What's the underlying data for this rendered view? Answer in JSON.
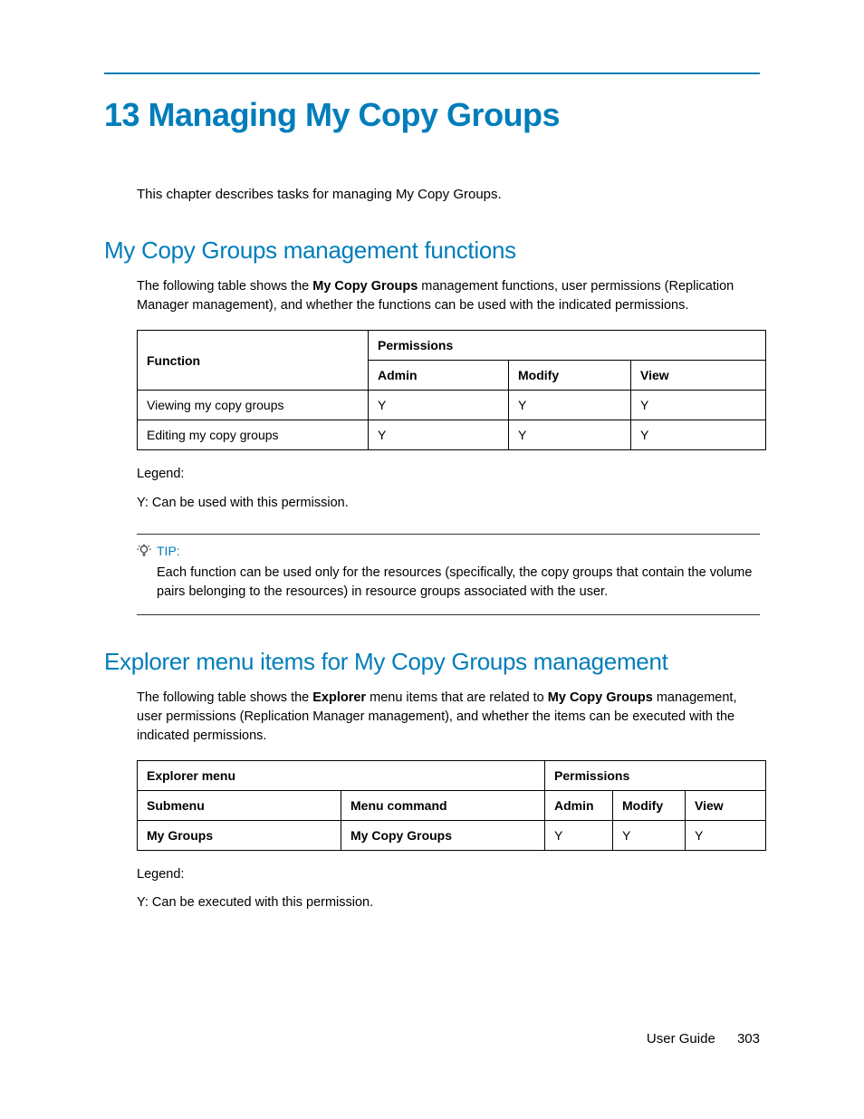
{
  "chapter_title": "13 Managing My Copy Groups",
  "intro": "This chapter describes tasks for managing My Copy Groups.",
  "section1": {
    "heading": "My Copy Groups management functions",
    "para_pre": "The following table shows the ",
    "para_bold": "My Copy Groups",
    "para_post": " management functions, user permissions (Replication Manager management), and whether the functions can be used with the indicated permissions.",
    "table": {
      "h_function": "Function",
      "h_permissions": "Permissions",
      "h_admin": "Admin",
      "h_modify": "Modify",
      "h_view": "View",
      "rows": [
        {
          "fn": "Viewing my copy groups",
          "admin": "Y",
          "modify": "Y",
          "view": "Y"
        },
        {
          "fn": "Editing my copy groups",
          "admin": "Y",
          "modify": "Y",
          "view": "Y"
        }
      ]
    },
    "legend1": "Legend:",
    "legend2": "Y: Can be used with this permission."
  },
  "tip": {
    "label": "TIP:",
    "body": "Each function can be used only for the resources (specifically, the copy groups that contain the volume pairs belonging to the resources) in resource groups associated with the user."
  },
  "section2": {
    "heading": "Explorer menu items for My Copy Groups management",
    "para_pre": "The following table shows the ",
    "para_bold1": "Explorer",
    "para_mid": " menu items that are related to ",
    "para_bold2": "My Copy Groups",
    "para_post": " management, user permissions (Replication Manager management), and whether the items can be executed with the indicated permissions.",
    "table": {
      "h_menu": "Explorer menu",
      "h_permissions": "Permissions",
      "h_submenu": "Submenu",
      "h_command": "Menu command",
      "h_admin": "Admin",
      "h_modify": "Modify",
      "h_view": "View",
      "rows": [
        {
          "submenu": "My Groups",
          "command": "My Copy Groups",
          "admin": "Y",
          "modify": "Y",
          "view": "Y"
        }
      ]
    },
    "legend1": "Legend:",
    "legend2": "Y: Can be executed with this permission."
  },
  "footer": {
    "label": "User Guide",
    "page": "303"
  }
}
